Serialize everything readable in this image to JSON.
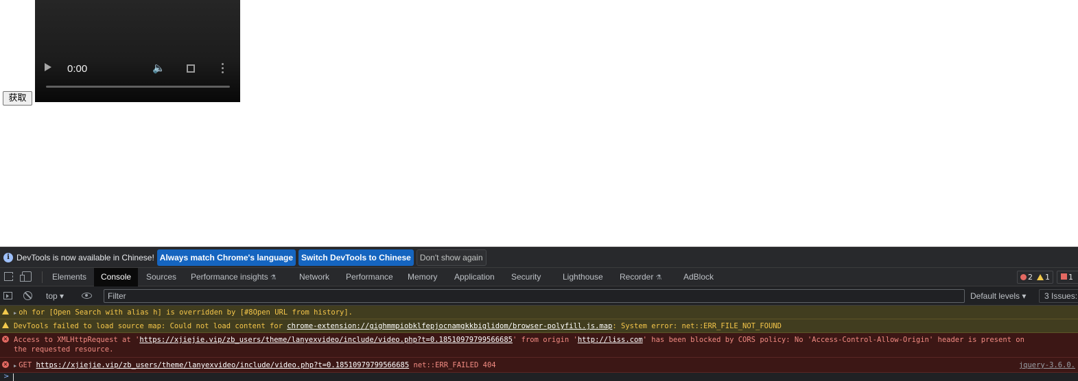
{
  "page": {
    "get_button_label": "获取",
    "video": {
      "time": "0:00"
    }
  },
  "devtools": {
    "infobar": {
      "message": "DevTools is now available in Chinese!",
      "btn_match": "Always match Chrome's language",
      "btn_switch": "Switch DevTools to Chinese",
      "btn_dismiss": "Don't show again"
    },
    "tabs": [
      {
        "label": "Elements"
      },
      {
        "label": "Console"
      },
      {
        "label": "Sources"
      },
      {
        "label": "Performance insights"
      },
      {
        "label": "Network"
      },
      {
        "label": "Performance"
      },
      {
        "label": "Memory"
      },
      {
        "label": "Application"
      },
      {
        "label": "Security"
      },
      {
        "label": "Lighthouse"
      },
      {
        "label": "Recorder"
      },
      {
        "label": "AdBlock"
      }
    ],
    "active_tab": "Console",
    "counters": {
      "errors": "2",
      "warnings": "1",
      "issues": "1"
    },
    "console_toolbar": {
      "context": "top",
      "filter_placeholder": "Filter",
      "levels": "Default levels",
      "issues": "3 Issues:"
    },
    "messages": [
      {
        "level": "warning",
        "text": "oh for [Open Search with alias h] is overridden by [#8Open URL from history]."
      },
      {
        "level": "warning",
        "prefix": "DevTools failed to load source map: Could not load content for ",
        "link": "chrome-extension://gighmmpiobklfepjocnamgkkbiglidom/browser-polyfill.js.map",
        "suffix": ": System error: net::ERR_FILE_NOT_FOUND"
      },
      {
        "level": "error",
        "prefix": "Access to XMLHttpRequest at '",
        "link": "https://xjiejie.vip/zb_users/theme/lanyexvideo/include/video.php?t=0.18510979799566685",
        "mid": "' from origin '",
        "origin": "http://liss.com",
        "suffix": "' has been blocked by CORS policy: No 'Access-Control-Allow-Origin' header is present on",
        "line2": "the requested resource."
      },
      {
        "level": "error",
        "method": "GET",
        "link": "https://xjiejie.vip/zb_users/theme/lanyexvideo/include/video.php?t=0.18510979799566685",
        "suffix": "net::ERR_FAILED 404",
        "source": "jquery-3.6.0."
      }
    ],
    "prompt": ">"
  }
}
